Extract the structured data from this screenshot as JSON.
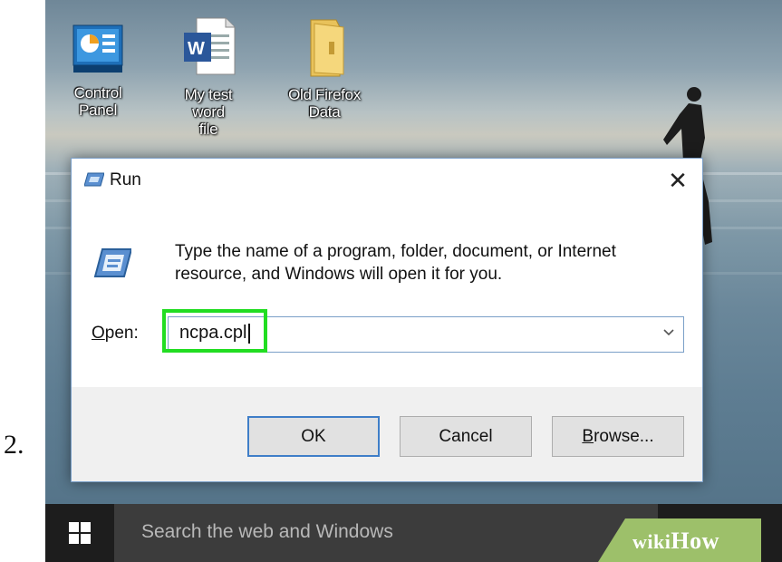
{
  "step_number": "2.",
  "desktop": {
    "icons": [
      {
        "name": "control-panel",
        "label_line1": "Control",
        "label_line2": "Panel",
        "icon": "control-panel-icon"
      },
      {
        "name": "word-file",
        "label_line1": "My test word",
        "label_line2": "file",
        "icon": "word-document-icon"
      },
      {
        "name": "firefox-data",
        "label_line1": "Old Firefox",
        "label_line2": "Data",
        "icon": "folder-icon"
      }
    ]
  },
  "run_dialog": {
    "title": "Run",
    "close_icon": "close-icon",
    "message": "Type the name of a program, folder, document, or Internet resource, and Windows will open it for you.",
    "open_label_mnemonic": "O",
    "open_label_rest": "pen:",
    "input_value": "ncpa.cpl",
    "buttons": {
      "ok": "OK",
      "cancel": "Cancel",
      "browse_mnemonic": "B",
      "browse_rest": "rowse..."
    },
    "highlight_color": "#22dd22"
  },
  "taskbar": {
    "search_placeholder": "Search the web and Windows",
    "start_icon": "windows-logo-icon",
    "task_view_icon": "task-view-icon"
  },
  "watermark": {
    "wiki": "wiki",
    "how": "How"
  }
}
